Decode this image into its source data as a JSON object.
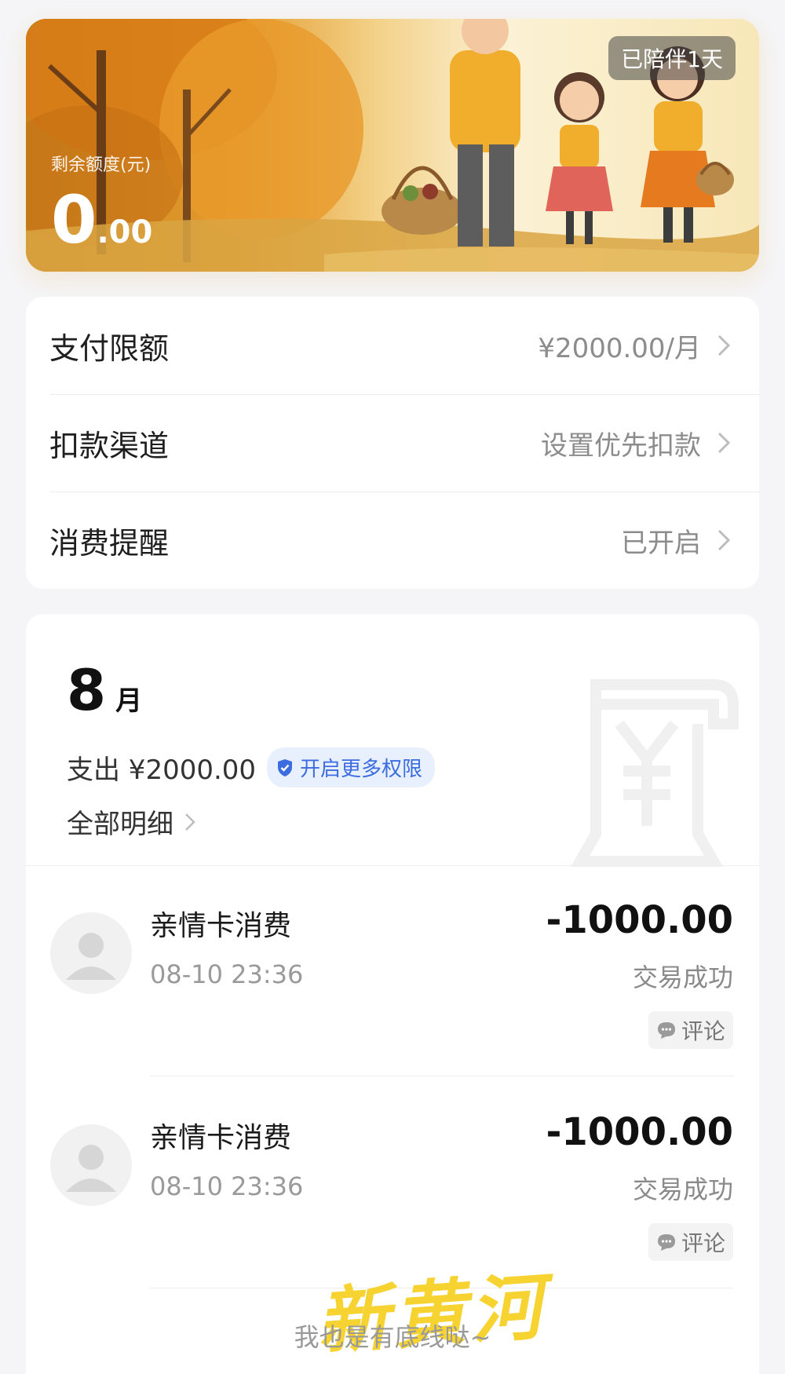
{
  "banner": {
    "balance_label": "剩余额度(元)",
    "balance_integer": "0",
    "balance_decimal": ".00",
    "companion_badge": "已陪伴1天"
  },
  "settings": {
    "rows": [
      {
        "label": "支付限额",
        "value": "¥2000.00/月"
      },
      {
        "label": "扣款渠道",
        "value": "设置优先扣款"
      },
      {
        "label": "消费提醒",
        "value": "已开启"
      }
    ]
  },
  "bills": {
    "month_number": "8",
    "month_unit": "月",
    "expense": "支出 ¥2000.00",
    "permission_pill": "开启更多权限",
    "all_details": "全部明细",
    "transactions": [
      {
        "title": "亲情卡消费",
        "time": "08-10 23:36",
        "amount": "-1000.00",
        "status": "交易成功",
        "comment": "评论"
      },
      {
        "title": "亲情卡消费",
        "time": "08-10 23:36",
        "amount": "-1000.00",
        "status": "交易成功",
        "comment": "评论"
      }
    ],
    "footer_note": "我也是有底线哒~"
  },
  "watermark": {
    "text": "新黄河"
  },
  "colors": {
    "accent_blue": "#3b6de0",
    "banner_orange": "#e39a2c",
    "page_bg": "#f5f5f7"
  },
  "icons": [
    "chevron-right-icon",
    "shield-check-icon",
    "yuan-bill-icon",
    "default-avatar-icon",
    "comment-bubble-icon"
  ]
}
